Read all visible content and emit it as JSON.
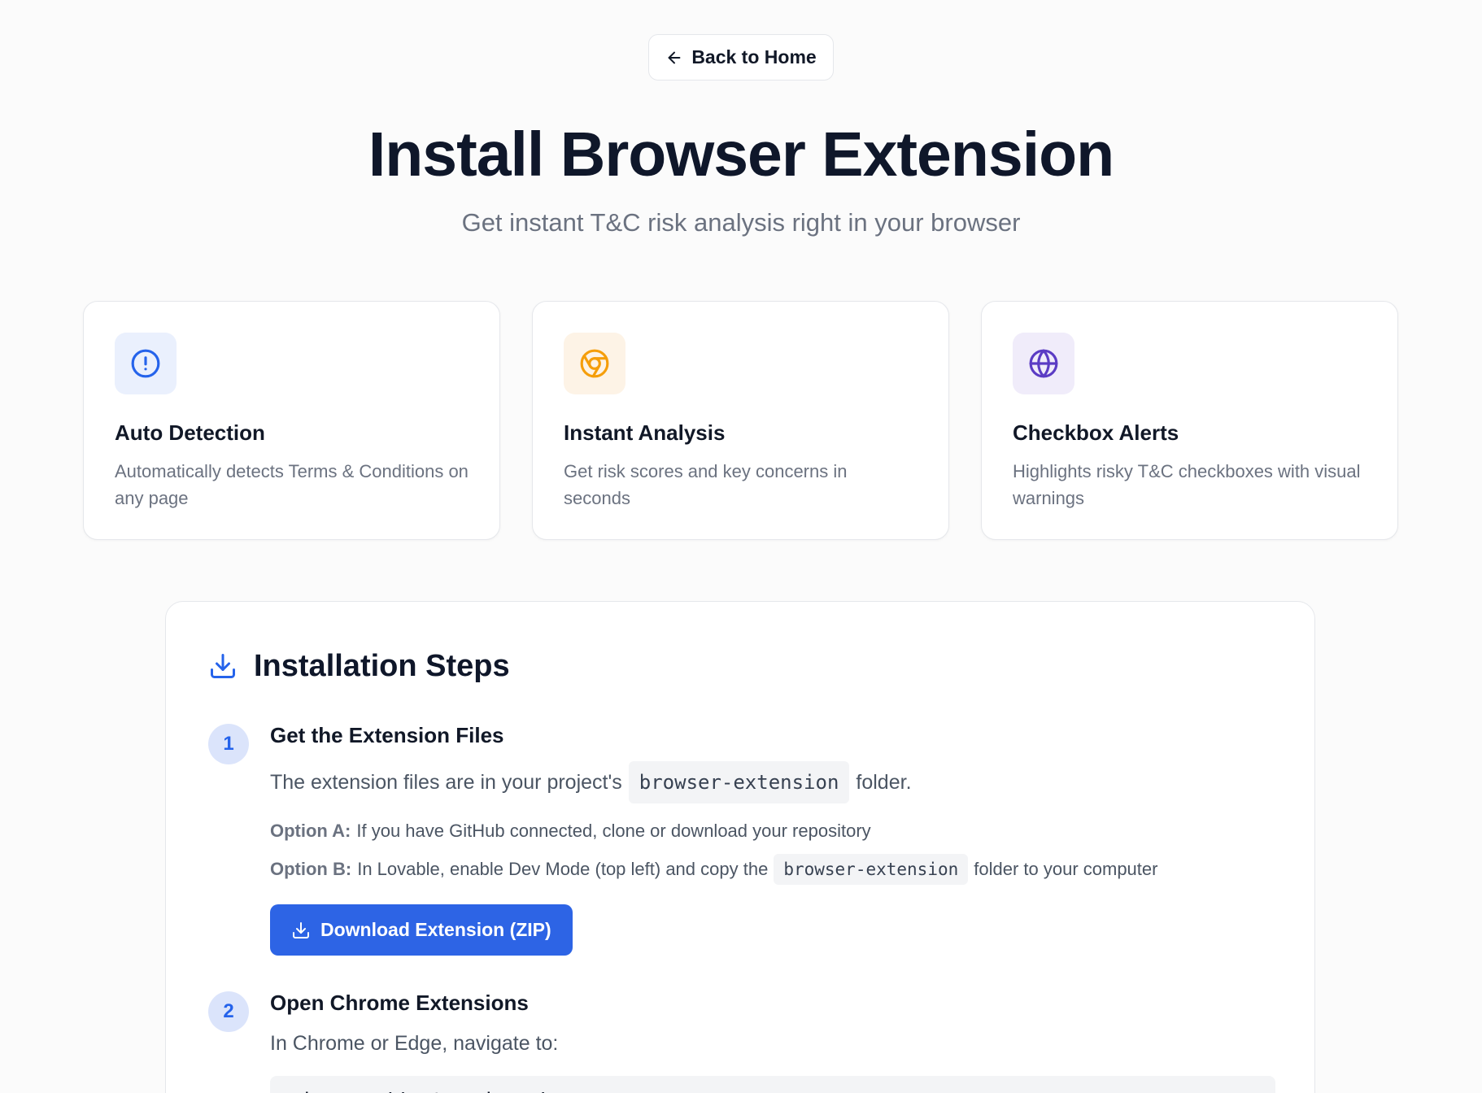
{
  "nav": {
    "back_label": "Back to Home"
  },
  "hero": {
    "title": "Install Browser Extension",
    "subtitle": "Get instant T&C risk analysis right in your browser"
  },
  "features": [
    {
      "title": "Auto Detection",
      "description": "Automatically detects Terms & Conditions on any page",
      "icon": "alert-circle-icon",
      "icon_color": "#2563eb",
      "icon_bg": "#eaf0fd"
    },
    {
      "title": "Instant Analysis",
      "description": "Get risk scores and key concerns in seconds",
      "icon": "chrome-icon",
      "icon_color": "#f59e0b",
      "icon_bg": "#fdf3e6"
    },
    {
      "title": "Checkbox Alerts",
      "description": "Highlights risky T&C checkboxes with visual warnings",
      "icon": "globe-icon",
      "icon_color": "#5b3cc4",
      "icon_bg": "#f0ecfa"
    }
  ],
  "steps_section": {
    "title": "Installation Steps",
    "steps": [
      {
        "number": "1",
        "title": "Get the Extension Files",
        "text_before": "The extension files are in your project's",
        "code": "browser-extension",
        "text_after": "folder.",
        "option_a_label": "Option A:",
        "option_a_text": "If you have GitHub connected, clone or download your repository",
        "option_b_label": "Option B:",
        "option_b_text_before": "In Lovable, enable Dev Mode (top left) and copy the",
        "option_b_code": "browser-extension",
        "option_b_text_after": "folder to your computer",
        "button_label": "Download Extension (ZIP)"
      },
      {
        "number": "2",
        "title": "Open Chrome Extensions",
        "text": "In Chrome or Edge, navigate to:",
        "code": "chrome://extensions/"
      }
    ]
  },
  "colors": {
    "accent": "#2d64e5",
    "step_badge_bg": "#dbe4fb"
  }
}
